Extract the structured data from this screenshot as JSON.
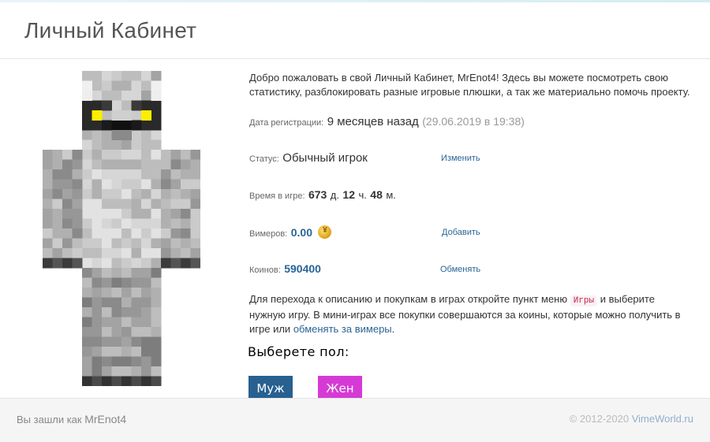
{
  "page": {
    "title": "Личный Кабинет"
  },
  "welcome_text": "Добро пожаловать в свой Личный Кабинет, MrEnot4! Здесь вы можете посмотреть свою статистику, разблокировать разные игровые плюшки, а так же материально помочь проекту.",
  "registration": {
    "label": "Дата регистрации:",
    "relative": "9 месяцев назад",
    "exact": "(29.06.2019 в 19:38)"
  },
  "status": {
    "label": "Статус:",
    "value": "Обычный игрок",
    "action": "Изменить"
  },
  "playtime": {
    "label": "Время в игре:",
    "days": "673",
    "days_unit": "д.",
    "hours": "12",
    "hours_unit": "ч.",
    "minutes": "48",
    "minutes_unit": "м."
  },
  "vimers": {
    "label": "Вимеров:",
    "value": "0.00",
    "action": "Добавить",
    "icon": "coin-icon"
  },
  "coins": {
    "label": "Коинов:",
    "value": "590400",
    "action": "Обменять"
  },
  "info": {
    "part1": "Для перехода к описанию и покупкам в играх откройте пункт меню",
    "menu_item": "Игры",
    "part2": "и выберите нужную игру. В мини-играх все покупки совершаются за коины, которые можно получить в игре или",
    "link": "обменять за вимеры",
    "end": "."
  },
  "gender": {
    "label": "Выберете пол:",
    "male": "Муж",
    "female": "Жен"
  },
  "footer": {
    "logged_as": "Вы зашли как",
    "username": "MrEnot4",
    "copyright": "© 2012-2020",
    "site": "VimeWorld.ru"
  },
  "colors": {
    "accent": "#2a6496",
    "male_button": "#286090",
    "female_button": "#d63ad6",
    "eyes": "#ffee00"
  }
}
